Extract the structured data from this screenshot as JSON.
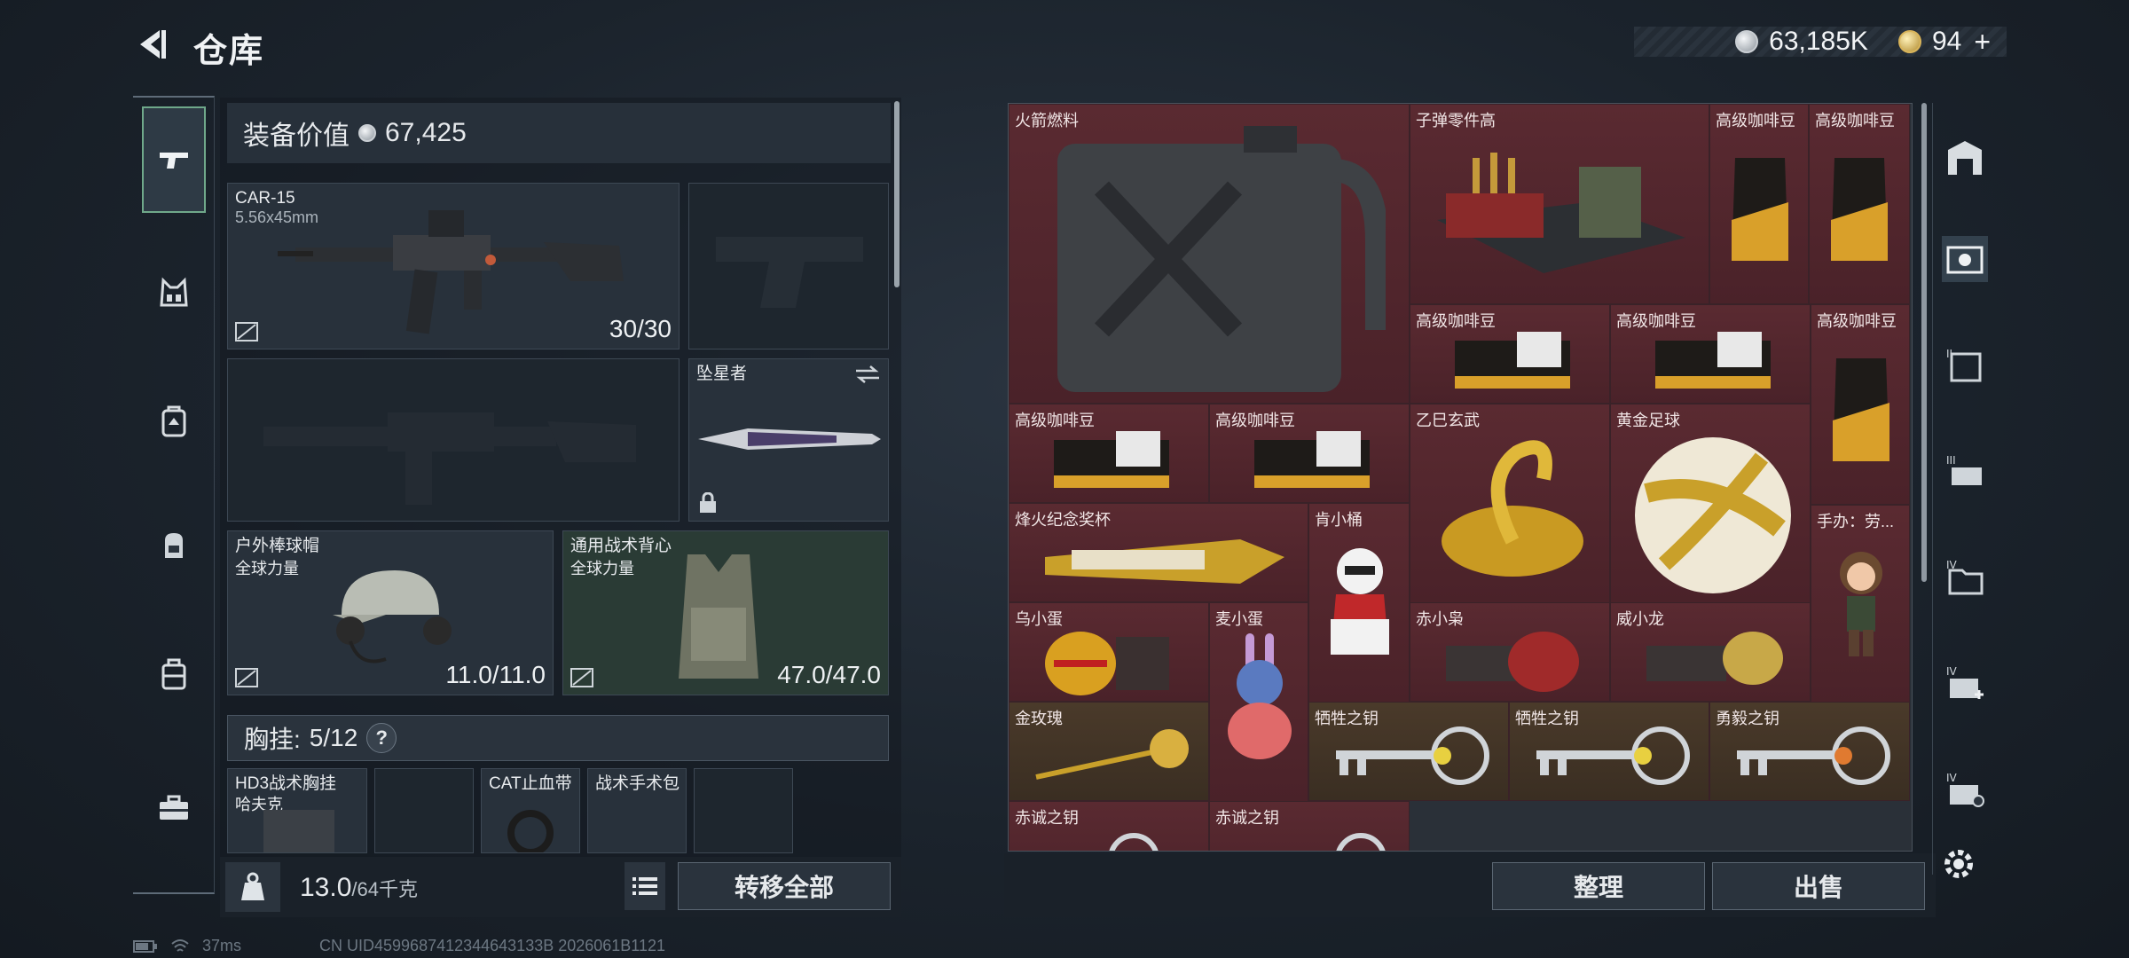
{
  "header": {
    "title": "仓库"
  },
  "currency": [
    {
      "icon": "silver-coin-icon",
      "value": "63,185K"
    },
    {
      "icon": "gold-coin-icon",
      "value": "94",
      "suffix": "+"
    }
  ],
  "left_nav": [
    {
      "icon": "pistol-icon",
      "active": true
    },
    {
      "icon": "chest-rig-icon",
      "active": false
    },
    {
      "icon": "backpack-icon",
      "active": false
    },
    {
      "icon": "pouch-icon",
      "active": false
    },
    {
      "icon": "case-icon",
      "active": false
    },
    {
      "icon": "toolbox-icon",
      "active": false
    }
  ],
  "loadout": {
    "value_label": "装备价值",
    "value": "67,425",
    "primary_weapon": {
      "name": "CAR-15",
      "caliber": "5.56x45mm",
      "ammo": "30/30"
    },
    "melee": {
      "name": "坠星者"
    },
    "helmet": {
      "name": "户外棒球帽",
      "maker": "全球力量",
      "durability": "11.0/11.0"
    },
    "armor": {
      "name": "通用战术背心",
      "maker": "全球力量",
      "durability": "47.0/47.0"
    },
    "chest_rig": {
      "label": "胸挂:",
      "capacity": "5/12",
      "help": "?"
    },
    "rig_items": [
      {
        "name": "HD3战术胸挂",
        "maker": "哈夫克"
      },
      {
        "name": ""
      },
      {
        "name": "CAT止血带"
      },
      {
        "name": "战术手术包"
      },
      {
        "name": ""
      }
    ],
    "weight": "13.0",
    "weight_max": "/64千克",
    "transfer_all": "转移全部"
  },
  "storage": {
    "items": [
      {
        "label": "火箭燃料",
        "color": "red"
      },
      {
        "label": "子弹零件高",
        "color": "red"
      },
      {
        "label": "高级咖啡豆",
        "color": "red"
      },
      {
        "label": "高级咖啡豆",
        "color": "red"
      },
      {
        "label": "高级咖啡豆",
        "color": "red"
      },
      {
        "label": "高级咖啡豆",
        "color": "red"
      },
      {
        "label": "高级咖啡豆",
        "color": "red"
      },
      {
        "label": "高级咖啡豆",
        "color": "red"
      },
      {
        "label": "高级咖啡豆",
        "color": "red"
      },
      {
        "label": "乙巳玄武",
        "color": "red"
      },
      {
        "label": "黄金足球",
        "color": "red"
      },
      {
        "label": "烽火纪念奖杯",
        "color": "red"
      },
      {
        "label": "肯小桶",
        "color": "red"
      },
      {
        "label": "手办：劳...",
        "color": "red"
      },
      {
        "label": "乌小蛋",
        "color": "red"
      },
      {
        "label": "麦小蛋",
        "color": "red"
      },
      {
        "label": "赤小枭",
        "color": "red"
      },
      {
        "label": "威小龙",
        "color": "red"
      },
      {
        "label": "金玫瑰",
        "color": "gold"
      },
      {
        "label": "牺牲之钥",
        "color": "gold"
      },
      {
        "label": "牺牲之钥",
        "color": "gold"
      },
      {
        "label": "勇毅之钥",
        "color": "gold"
      },
      {
        "label": "赤诚之钥",
        "color": "red"
      },
      {
        "label": "赤诚之钥",
        "color": "red"
      }
    ],
    "sort_label": "整理",
    "sell_label": "出售"
  },
  "right_nav": [
    {
      "icon": "vault-icon"
    },
    {
      "icon": "storage-crate-icon"
    },
    {
      "icon": "tier-ii-storage-icon"
    },
    {
      "icon": "tier-iii-storage-icon"
    },
    {
      "icon": "tier-iv-folder-icon"
    },
    {
      "icon": "tier-iv-add-icon"
    },
    {
      "icon": "tier-iv-lock-icon"
    },
    {
      "icon": "settings-gear-icon"
    }
  ],
  "status": {
    "ping": "37ms",
    "uid": "CN UID4599687412344643133B 2026061B1121"
  },
  "colors": {
    "accent_green": "#6fa88a",
    "rare_red": "#5a2a31",
    "gold_bg": "#4a3a2a"
  }
}
